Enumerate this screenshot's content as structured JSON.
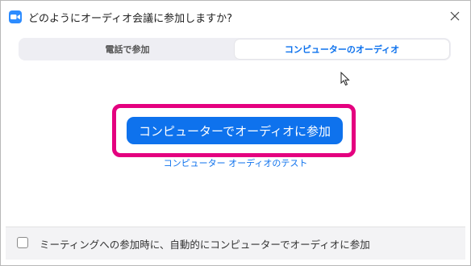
{
  "window": {
    "title": "どのようにオーディオ会議に参加しますか?",
    "close_symbol": "✕"
  },
  "tabs": [
    {
      "label": "電話で参加",
      "active": false
    },
    {
      "label": "コンピューターのオーディオ",
      "active": true
    }
  ],
  "main": {
    "join_button_label": "コンピューターでオーディオに参加",
    "test_link_label": "コンピューター オーディオのテスト"
  },
  "footer": {
    "checkbox_label": "ミーティングへの参加時に、自動的にコンピューターでオーディオに参加",
    "checked": false
  },
  "icons": {
    "app": "zoom-camera-icon",
    "close": "close-icon",
    "cursor": "mouse-pointer-icon"
  },
  "colors": {
    "accent": "#0e72ed",
    "highlight": "#e4007f",
    "app_icon": "#2d8cff"
  }
}
